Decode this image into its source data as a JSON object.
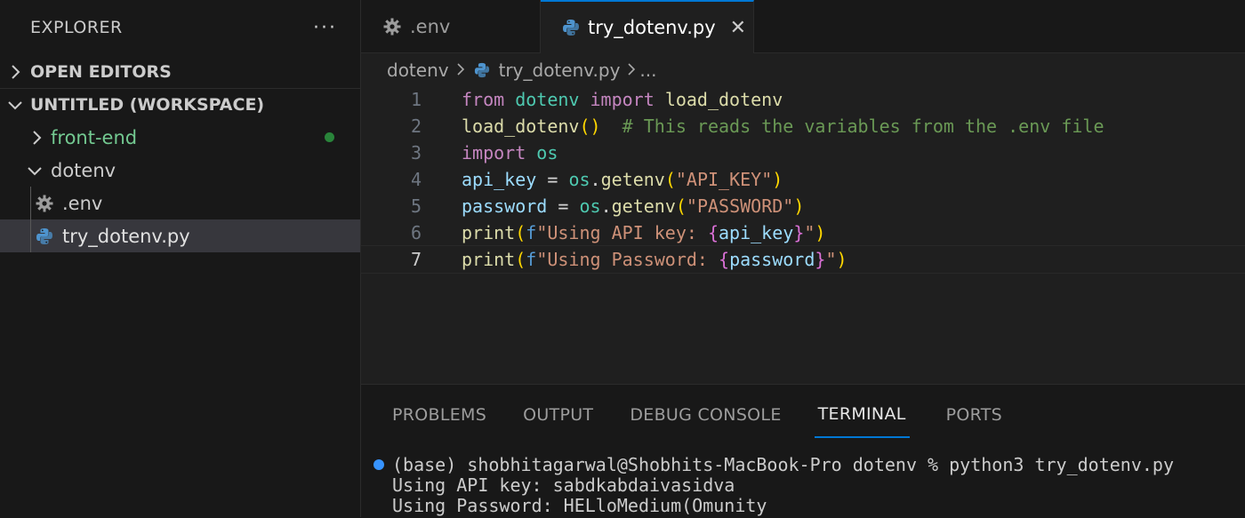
{
  "explorer": {
    "title": "EXPLORER",
    "more": "···",
    "open_editors": "OPEN EDITORS",
    "workspace": "UNTITLED (WORKSPACE)",
    "tree": [
      {
        "label": "front-end",
        "color": "#73c991"
      },
      {
        "label": "dotenv"
      },
      {
        "label": ".env"
      },
      {
        "label": "try_dotenv.py"
      }
    ]
  },
  "tabs": [
    {
      "label": ".env",
      "icon": "gear-icon"
    },
    {
      "label": "try_dotenv.py",
      "icon": "python-icon",
      "close": "✕"
    }
  ],
  "breadcrumbs": {
    "folder": "dotenv",
    "file": "try_dotenv.py",
    "more": "..."
  },
  "code": {
    "line_numbers": [
      "1",
      "2",
      "3",
      "4",
      "5",
      "6",
      "7"
    ],
    "lines": [
      "from dotenv import load_dotenv",
      "load_dotenv()  # This reads the variables from the .env file",
      "import os",
      "api_key = os.getenv(\"API_KEY\")",
      "password = os.getenv(\"PASSWORD\")",
      "print(f\"Using API key: {api_key}\")",
      "print(f\"Using Password: {password}\")"
    ]
  },
  "panel": {
    "tabs": [
      "PROBLEMS",
      "OUTPUT",
      "DEBUG CONSOLE",
      "TERMINAL",
      "PORTS"
    ],
    "terminal": [
      "(base) shobhitagarwal@Shobhits-MacBook-Pro dotenv % python3 try_dotenv.py",
      "Using API key: sabdkabdaivasidva",
      "Using Password: HELloMedium(Omunity"
    ]
  }
}
